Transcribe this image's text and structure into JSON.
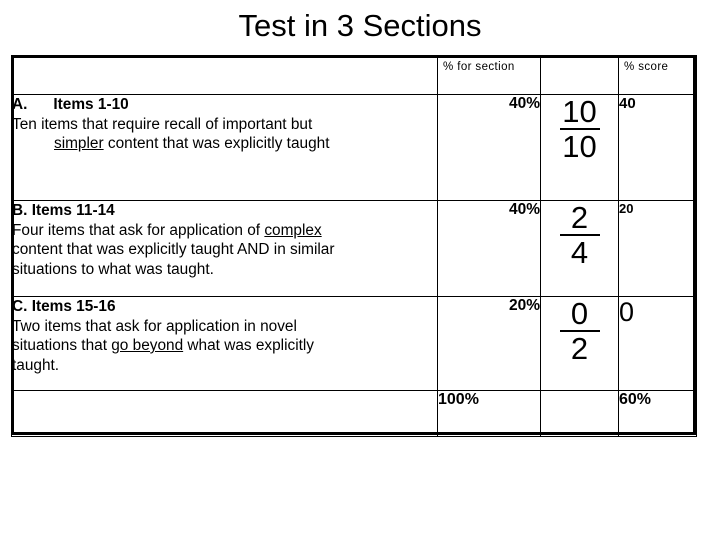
{
  "slide": {
    "title": "Test in 3 Sections",
    "background_color": "#ffffff",
    "text_color": "#000000"
  },
  "table": {
    "headers": {
      "description": "",
      "percent_for_section": "% for section",
      "fraction": "",
      "percent_score": "% score"
    },
    "rows": [
      {
        "label": "A.",
        "label_spacer": "",
        "title": "Items 1-10",
        "line1": "Ten items that require recall of important but",
        "line2_underlined": "simpler",
        "line2_rest": " content that was explicitly taught",
        "percent_for_section": "40%",
        "fraction_numerator": "10",
        "fraction_denominator": "10",
        "score": "40"
      },
      {
        "label": "B.",
        "title": "Items 11-14",
        "line1_pre": "Four items that ask for application of ",
        "line1_underlined": "complex",
        "line2": "content that was explicitly taught AND in similar",
        "line3": "situations to what was taught.",
        "percent_for_section": "40%",
        "fraction_numerator": "2",
        "fraction_denominator": "4",
        "score": "20"
      },
      {
        "label": "C.",
        "title": "Items 15-16",
        "line1": "Two items that ask for application in novel",
        "line2_pre": "situations that ",
        "line2_underlined": "go beyond",
        "line2_rest": " what was explicitly",
        "line3": "taught.",
        "percent_for_section": "20%",
        "fraction_numerator": "0",
        "fraction_denominator": "2",
        "score": "0"
      }
    ],
    "totals": {
      "percent_for_section": "100%",
      "fraction": "",
      "percent_score": "60%"
    }
  }
}
